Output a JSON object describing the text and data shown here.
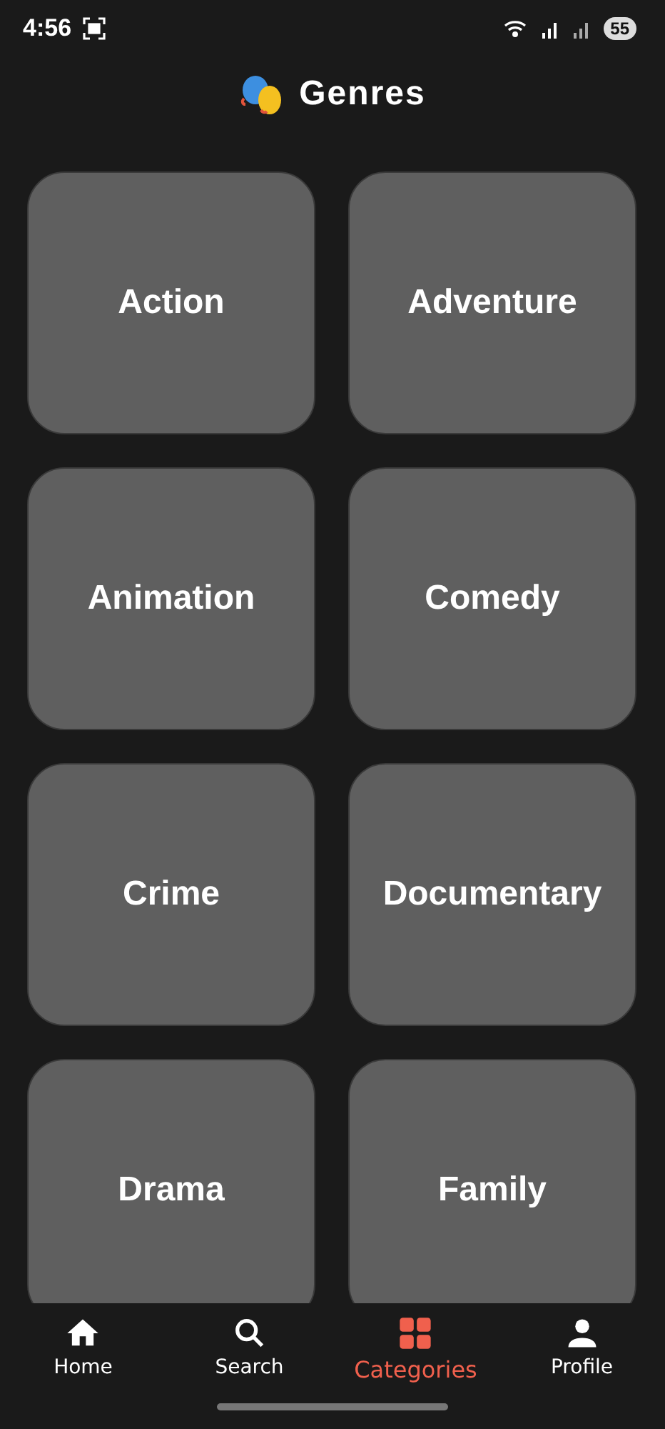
{
  "status_bar": {
    "time": "4:56",
    "battery": "55"
  },
  "header": {
    "title": "Genres"
  },
  "genres": [
    {
      "label": "Action"
    },
    {
      "label": "Adventure"
    },
    {
      "label": "Animation"
    },
    {
      "label": "Comedy"
    },
    {
      "label": "Crime"
    },
    {
      "label": "Documentary"
    },
    {
      "label": "Drama"
    },
    {
      "label": "Family"
    }
  ],
  "nav": [
    {
      "kind": "home",
      "label": "Home",
      "selected": false
    },
    {
      "kind": "search",
      "label": "Search",
      "selected": false
    },
    {
      "kind": "grid",
      "label": "Categories",
      "selected": true
    },
    {
      "kind": "person",
      "label": "Profile",
      "selected": false
    }
  ]
}
